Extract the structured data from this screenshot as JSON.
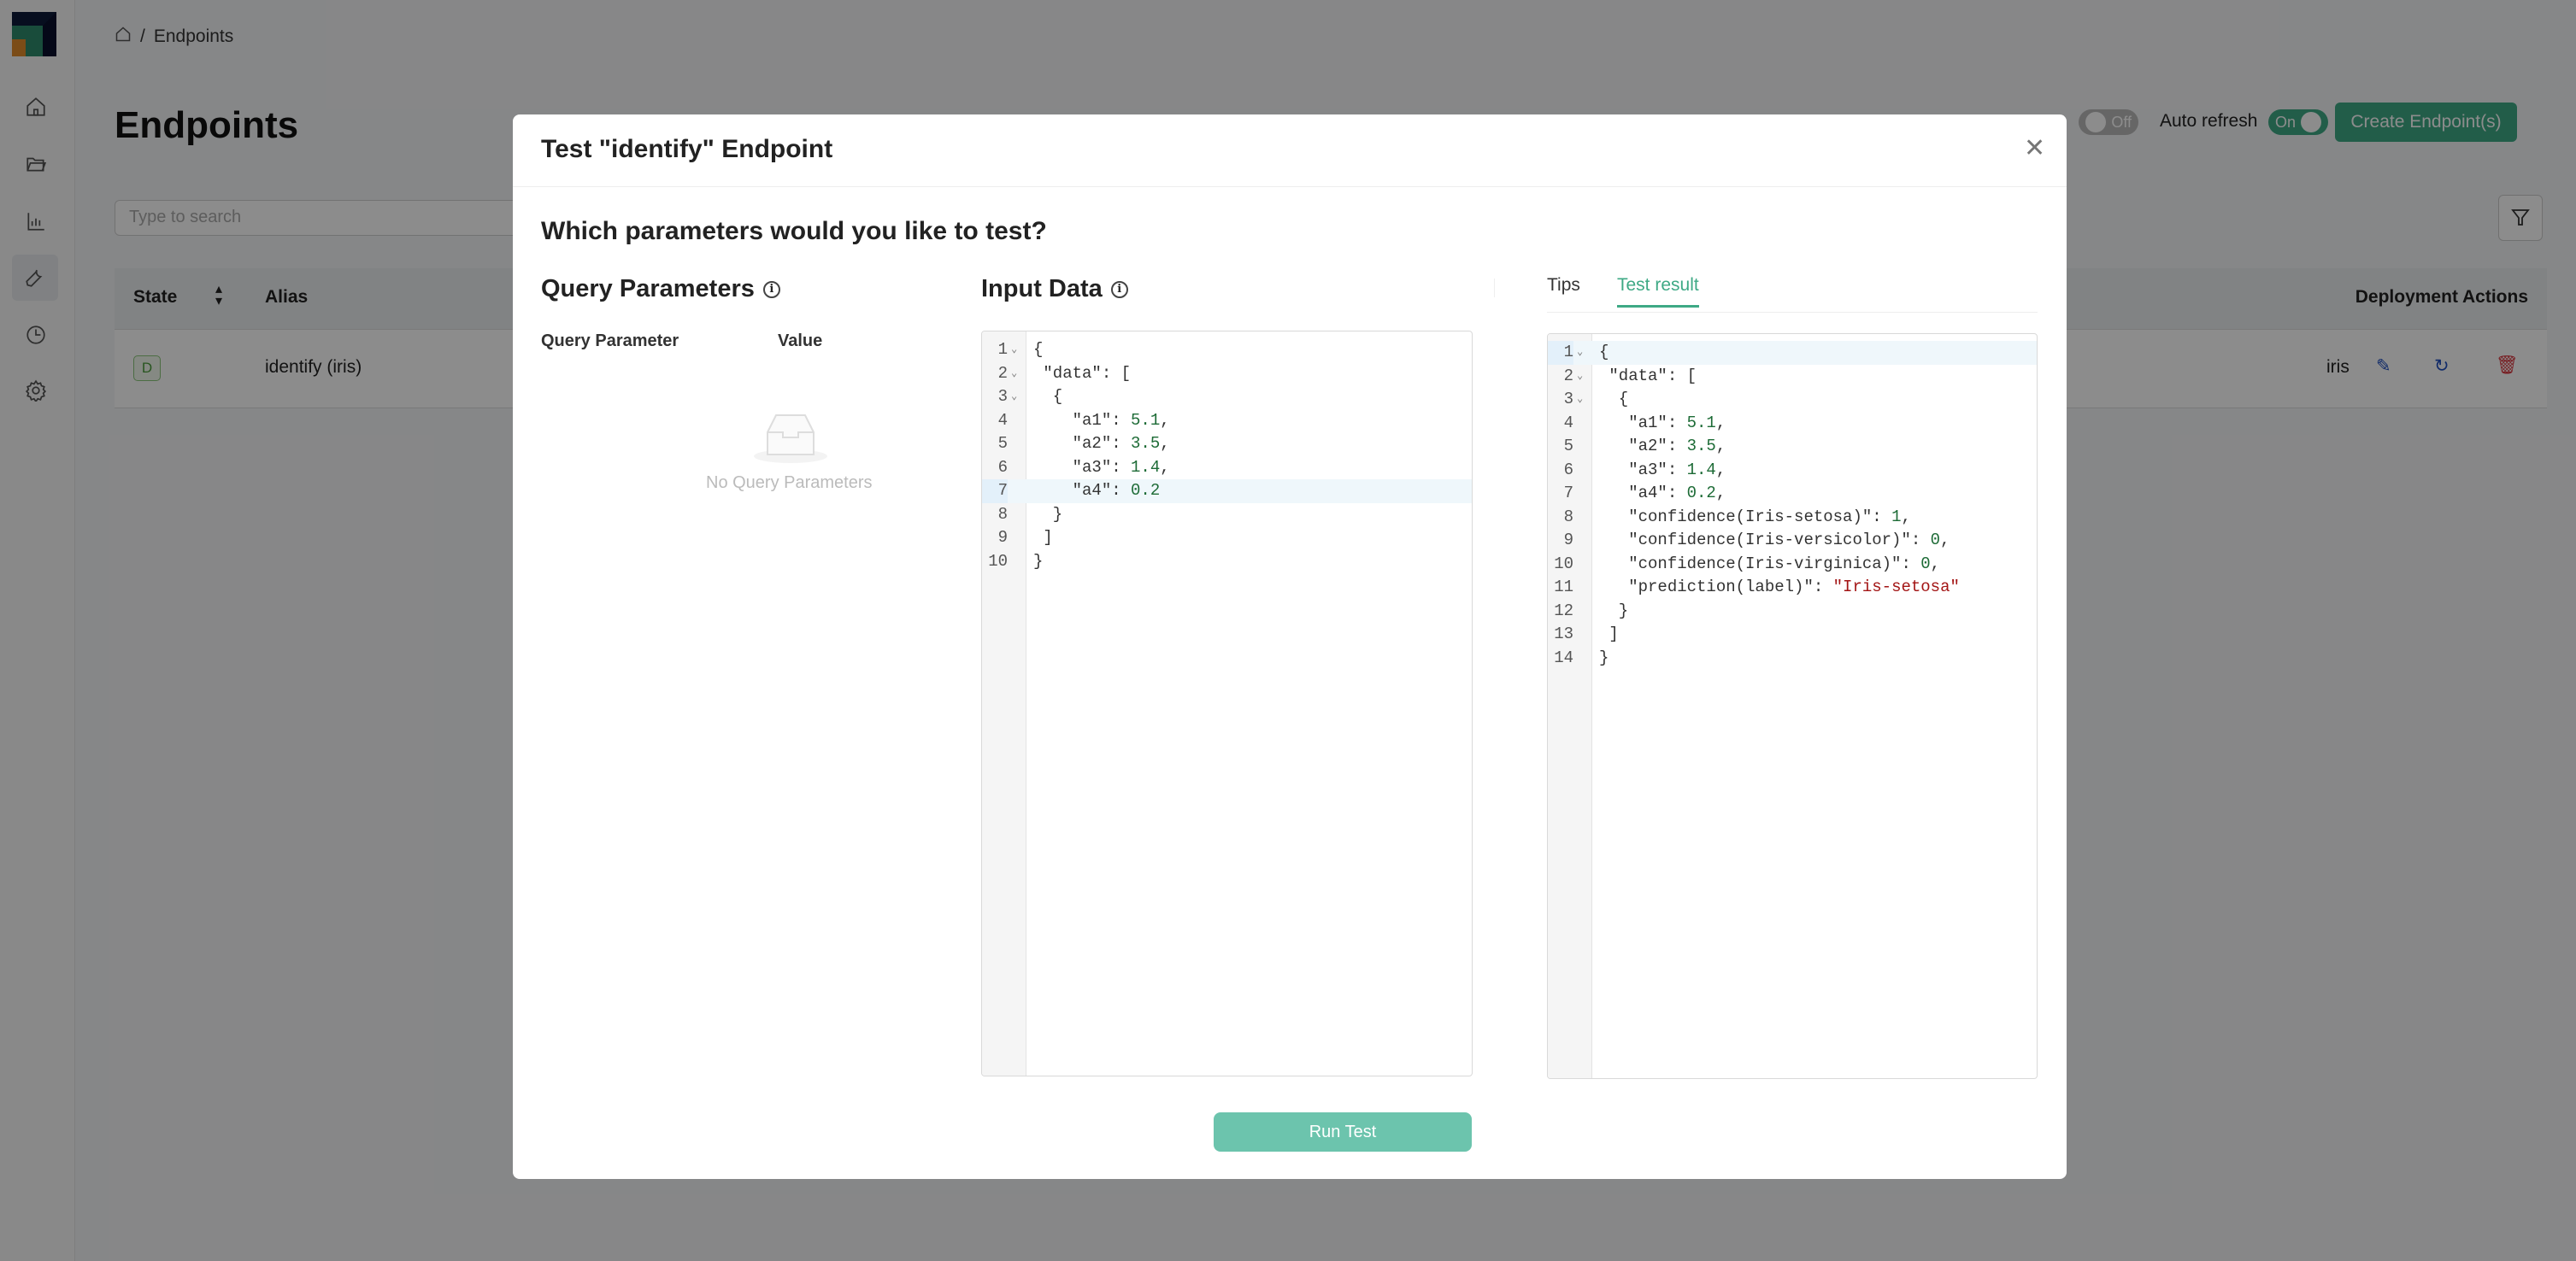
{
  "breadcrumb": {
    "current": "Endpoints"
  },
  "page": {
    "title": "Endpoints",
    "search_placeholder": "Type to search"
  },
  "toolbar": {
    "toggle1_state": "Off",
    "auto_refresh_label": "Auto refresh",
    "auto_refresh_state": "On",
    "create_label": "Create Endpoint(s)"
  },
  "table": {
    "headers": {
      "state": "State",
      "alias": "Alias",
      "actions": "Deployment Actions"
    },
    "row": {
      "state": "D",
      "alias": "identify (iris)",
      "project": "iris"
    }
  },
  "colors": {
    "accent": "#3ea985",
    "run_button": "#6cc4ad",
    "delete": "#d9363e",
    "edit": "#1f4fbf"
  },
  "modal": {
    "title": "Test \"identify\" Endpoint",
    "question": "Which parameters would you like to test?",
    "query": {
      "heading": "Query Parameters",
      "col_param": "Query Parameter",
      "col_value": "Value",
      "empty": "No Query Parameters"
    },
    "input": {
      "heading": "Input Data",
      "active_line": 7,
      "fold_lines": [
        1,
        2,
        3
      ],
      "lines": [
        [
          [
            "{",
            ""
          ]
        ],
        [
          [
            " \"data\": [",
            ""
          ]
        ],
        [
          [
            "  {",
            ""
          ]
        ],
        [
          [
            "    \"a1\": ",
            ""
          ],
          [
            "5.1",
            "num"
          ],
          [
            ",",
            ""
          ]
        ],
        [
          [
            "    \"a2\": ",
            ""
          ],
          [
            "3.5",
            "num"
          ],
          [
            ",",
            ""
          ]
        ],
        [
          [
            "    \"a3\": ",
            ""
          ],
          [
            "1.4",
            "num"
          ],
          [
            ",",
            ""
          ]
        ],
        [
          [
            "    \"a4\": ",
            ""
          ],
          [
            "0.2",
            "num"
          ]
        ],
        [
          [
            "  }",
            ""
          ]
        ],
        [
          [
            " ]",
            ""
          ]
        ],
        [
          [
            "}",
            ""
          ]
        ]
      ]
    },
    "tabs": [
      {
        "label": "Tips",
        "active": false
      },
      {
        "label": "Test result",
        "active": true
      }
    ],
    "result": {
      "active_line": 1,
      "fold_lines": [
        1,
        2,
        3
      ],
      "lines": [
        [
          [
            "{",
            ""
          ]
        ],
        [
          [
            " \"data\": [",
            ""
          ]
        ],
        [
          [
            "  {",
            ""
          ]
        ],
        [
          [
            "   \"a1\": ",
            ""
          ],
          [
            "5.1",
            "num"
          ],
          [
            ",",
            ""
          ]
        ],
        [
          [
            "   \"a2\": ",
            ""
          ],
          [
            "3.5",
            "num"
          ],
          [
            ",",
            ""
          ]
        ],
        [
          [
            "   \"a3\": ",
            ""
          ],
          [
            "1.4",
            "num"
          ],
          [
            ",",
            ""
          ]
        ],
        [
          [
            "   \"a4\": ",
            ""
          ],
          [
            "0.2",
            "num"
          ],
          [
            ",",
            ""
          ]
        ],
        [
          [
            "   \"confidence(Iris-setosa)\": ",
            ""
          ],
          [
            "1",
            "num"
          ],
          [
            ",",
            ""
          ]
        ],
        [
          [
            "   \"confidence(Iris-versicolor)\": ",
            ""
          ],
          [
            "0",
            "num"
          ],
          [
            ",",
            ""
          ]
        ],
        [
          [
            "   \"confidence(Iris-virginica)\": ",
            ""
          ],
          [
            "0",
            "num"
          ],
          [
            ",",
            ""
          ]
        ],
        [
          [
            "   \"prediction(label)\": ",
            ""
          ],
          [
            "\"Iris-setosa\"",
            "str"
          ]
        ],
        [
          [
            "  }",
            ""
          ]
        ],
        [
          [
            " ]",
            ""
          ]
        ],
        [
          [
            "}",
            ""
          ]
        ]
      ]
    },
    "run_label": "Run Test"
  }
}
